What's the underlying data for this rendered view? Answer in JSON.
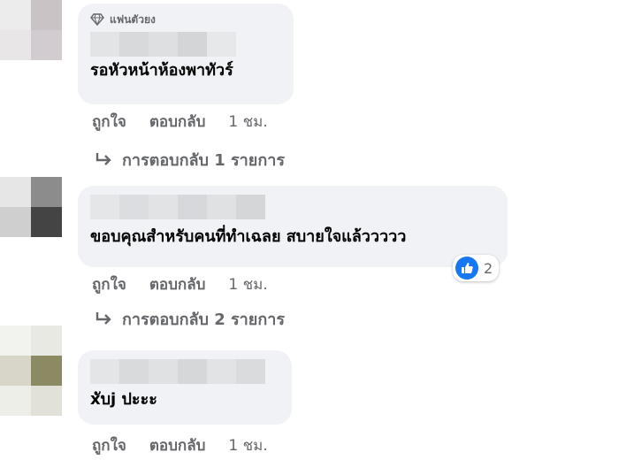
{
  "comments": [
    {
      "badge": "แฟนตัวยง",
      "text": "รอหัวหน้าห้องพาทัวร์",
      "actions": {
        "like": "ถูกใจ",
        "reply": "ตอบกลับ",
        "time": "1 ชม."
      },
      "replies_label": "การตอบกลับ 1 รายการ"
    },
    {
      "text": "ขอบคุณสำหรับคนที่ทำเฉลย สบายใจแล้ววววว",
      "reaction_count": "2",
      "actions": {
        "like": "ถูกใจ",
        "reply": "ตอบกลับ",
        "time": "1 ชม."
      },
      "replies_label": "การตอบกลับ 2 รายการ"
    },
    {
      "text": "xับj ปะะะ",
      "actions": {
        "like": "ถูกใจ",
        "reply": "ตอบกลับ",
        "time": "1 ชม."
      }
    }
  ],
  "colors": {
    "bubble": "#f0f2f5",
    "meta_text": "#65676b",
    "like_blue": "#1877f2"
  }
}
